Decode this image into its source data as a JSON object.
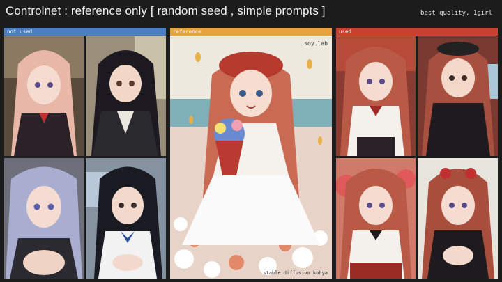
{
  "header": {
    "title": "Controlnet : reference only [ random seed , simple prompts ]",
    "prompt_hint": "best quality, 1girl"
  },
  "panels": [
    {
      "label": "not used",
      "color": "#4a7fc4"
    },
    {
      "label": "reference",
      "color": "#e8a23d"
    },
    {
      "label": "used",
      "color": "#c8412e"
    }
  ],
  "reference_image": {
    "watermark_top": "soy.lab",
    "watermark_bottom": "stable diffusion kohya"
  }
}
